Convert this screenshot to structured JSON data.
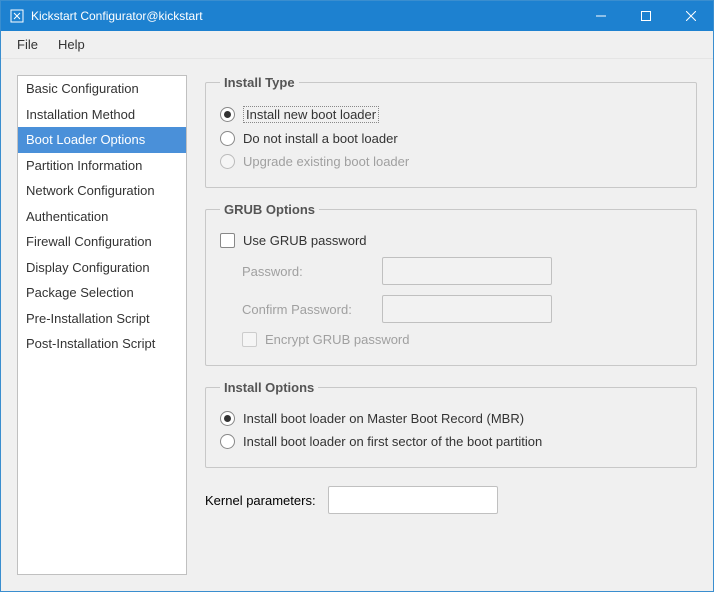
{
  "window": {
    "title": "Kickstart Configurator@kickstart"
  },
  "menubar": {
    "file": "File",
    "help": "Help"
  },
  "sidebar": {
    "items": [
      "Basic Configuration",
      "Installation Method",
      "Boot Loader Options",
      "Partition Information",
      "Network Configuration",
      "Authentication",
      "Firewall Configuration",
      "Display Configuration",
      "Package Selection",
      "Pre-Installation Script",
      "Post-Installation Script"
    ],
    "selected_index": 2
  },
  "install_type": {
    "legend": "Install Type",
    "install_new": "Install new boot loader",
    "do_not_install": "Do not install a boot loader",
    "upgrade": "Upgrade existing boot loader"
  },
  "grub_options": {
    "legend": "GRUB Options",
    "use_password": "Use GRUB password",
    "password_label": "Password:",
    "confirm_label": "Confirm Password:",
    "encrypt": "Encrypt GRUB password"
  },
  "install_options": {
    "legend": "Install Options",
    "mbr": "Install boot loader on Master Boot Record (MBR)",
    "first_sector": "Install boot loader on first sector of the boot partition"
  },
  "kernel": {
    "label": "Kernel parameters:",
    "value": ""
  }
}
